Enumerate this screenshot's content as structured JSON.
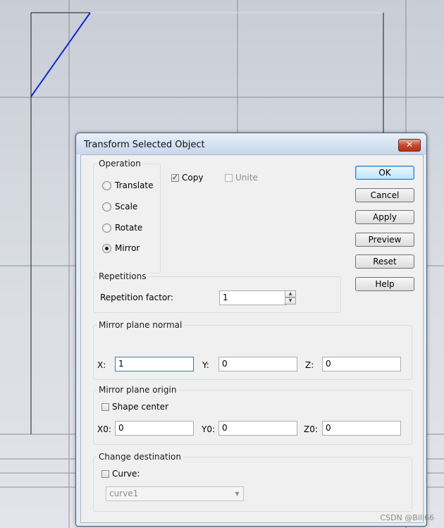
{
  "dialog": {
    "title": "Transform Selected Object",
    "close_symbol": "✕"
  },
  "operation": {
    "legend": "Operation",
    "options": [
      "Translate",
      "Scale",
      "Rotate",
      "Mirror"
    ],
    "selected": "Mirror"
  },
  "copy": {
    "label": "Copy",
    "checked": true
  },
  "unite": {
    "label": "Unite",
    "checked": false,
    "enabled": false
  },
  "buttons": {
    "ok": "OK",
    "cancel": "Cancel",
    "apply": "Apply",
    "preview": "Preview",
    "reset": "Reset",
    "help": "Help"
  },
  "repetitions": {
    "legend": "Repetitions",
    "factor_label": "Repetition factor:",
    "factor_value": "1",
    "spin_up": "▲",
    "spin_down": "▼"
  },
  "mirror_normal": {
    "legend": "Mirror plane normal",
    "x_label": "X:",
    "x_value": "1",
    "y_label": "Y:",
    "y_value": "0",
    "z_label": "Z:",
    "z_value": "0"
  },
  "mirror_origin": {
    "legend": "Mirror plane origin",
    "shape_center_label": "Shape center",
    "shape_center_checked": false,
    "x0_label": "X0:",
    "x0_value": "0",
    "y0_label": "Y0:",
    "y0_value": "0",
    "z0_label": "Z0:",
    "z0_value": "0"
  },
  "destination": {
    "legend": "Change destination",
    "curve_label": "Curve:",
    "curve_checked": false,
    "curve_value": "curve1",
    "dropdown_symbol": "▼"
  },
  "watermark": "CSDN @Bill66",
  "colors": {
    "viewport_line": "#7e828a",
    "shape_edge": "#1a1a1a",
    "selected_edge": "#0a2bd6",
    "dialog_frame": "#e4ecf6"
  }
}
